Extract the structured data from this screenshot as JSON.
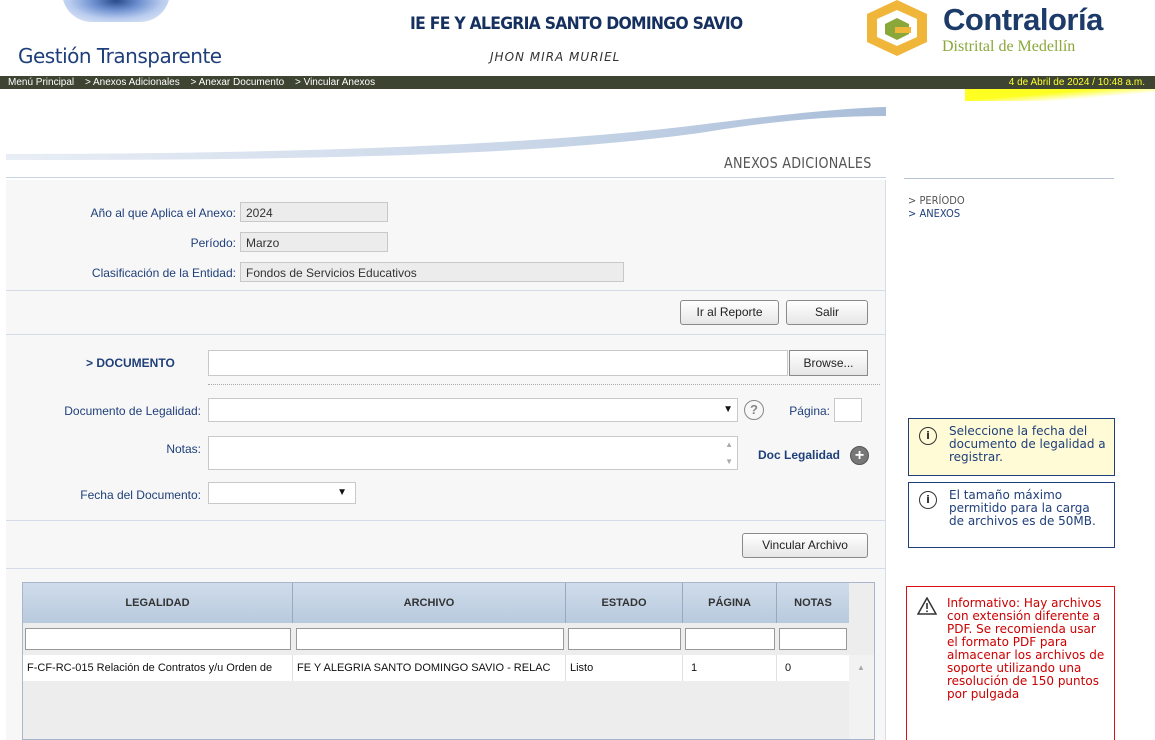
{
  "header": {
    "logo_text": "Gestión Transparente",
    "school_name": "IE FE Y ALEGRIA SANTO DOMINGO SAVIO",
    "person_name": "JHON MIRA MURIEL",
    "contraloria_title": "Contraloría",
    "contraloria_sub": "Distrital de Medellín"
  },
  "nav": {
    "crumbs": [
      "Menú Principal",
      "> Anexos Adicionales",
      "> Anexar Documento",
      "> Vincular Anexos"
    ],
    "date": "4 de Abril de 2024 / 10:48 a.m."
  },
  "section_title": "ANEXOS ADICIONALES",
  "form": {
    "anio_label": "Año al que Aplica el Anexo:",
    "anio_value": "2024",
    "periodo_label": "Período:",
    "periodo_value": "Marzo",
    "clasif_label": "Clasificación de la Entidad:",
    "clasif_value": "Fondos de Servicios Educativos",
    "ir_reporte": "Ir al Reporte",
    "salir": "Salir",
    "documento_label": "> DOCUMENTO",
    "browse": "Browse...",
    "legalidad_label": "Documento de Legalidad:",
    "pagina_label": "Página:",
    "notas_label": "Notas:",
    "doc_legalidad_link": "Doc Legalidad",
    "fecha_label": "Fecha del Documento:",
    "vincular": "Vincular Archivo"
  },
  "grid": {
    "columns": [
      "LEGALIDAD",
      "ARCHIVO",
      "ESTADO",
      "PÁGINA",
      "NOTAS"
    ],
    "rows": [
      [
        "F-CF-RC-015 Relación de Contratos y/u Orden de",
        "FE Y ALEGRIA SANTO DOMINGO SAVIO - RELAC",
        "Listo",
        "1",
        "0"
      ]
    ]
  },
  "sidebar": {
    "nav": [
      "> PERÍODO",
      "> ANEXOS"
    ],
    "info1": "Seleccione la fecha del documento de legalidad a registrar.",
    "info2": "El tamaño máximo permitido para la carga de archivos es de 50MB.",
    "warning": "Informativo: Hay archivos con extensión diferente a PDF. Se recomienda usar el formato PDF para almacenar los archivos de soporte utilizando una resolución de 150 puntos por pulgada"
  },
  "colors": {
    "navbar": "#3d4431",
    "brand_blue": "#1f3f7a",
    "date_yellow": "#ffff33",
    "warning_red": "#cc0000"
  }
}
